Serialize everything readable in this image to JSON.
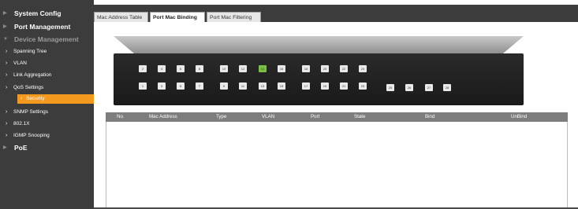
{
  "sidebar": {
    "items": [
      {
        "label": "System Config"
      },
      {
        "label": "Port Management"
      },
      {
        "label": "Device Management"
      },
      {
        "label": "PoE"
      }
    ],
    "sub_items": [
      {
        "label": "Spanning Tree"
      },
      {
        "label": "VLAN"
      },
      {
        "label": "Link Aggregation"
      },
      {
        "label": "QoS Settings"
      },
      {
        "label": "Security"
      },
      {
        "label": "SNMP Settings"
      },
      {
        "label": "802.1X"
      },
      {
        "label": "IGMP Snooping"
      }
    ],
    "active_sub_index": 4
  },
  "tabs": [
    {
      "label": "Mac Address Table"
    },
    {
      "label": "Port Mac Binding"
    },
    {
      "label": "Port Mac Filtering"
    }
  ],
  "active_tab_index": 1,
  "switch": {
    "top_ports": [
      "2",
      "4",
      "6",
      "8",
      "10",
      "12",
      "14",
      "16",
      "18",
      "20",
      "22",
      "24"
    ],
    "bottom_ports": [
      "1",
      "3",
      "5",
      "7",
      "9",
      "11",
      "13",
      "15",
      "17",
      "19",
      "21",
      "23"
    ],
    "sfp_ports": [
      "25",
      "26",
      "27",
      "28"
    ],
    "linked_port": "14",
    "colors": {
      "linked": "#7ac142",
      "idle": "#e9e9e9"
    }
  },
  "table": {
    "columns": [
      "No.",
      "Mac Address",
      "Type",
      "VLAN",
      "Port",
      "State",
      "Bind",
      "UnBind"
    ],
    "rows": []
  },
  "colors": {
    "accent": "#f39a1e",
    "sidebar": "#3c3c3c",
    "header": "#7d7d7d"
  }
}
